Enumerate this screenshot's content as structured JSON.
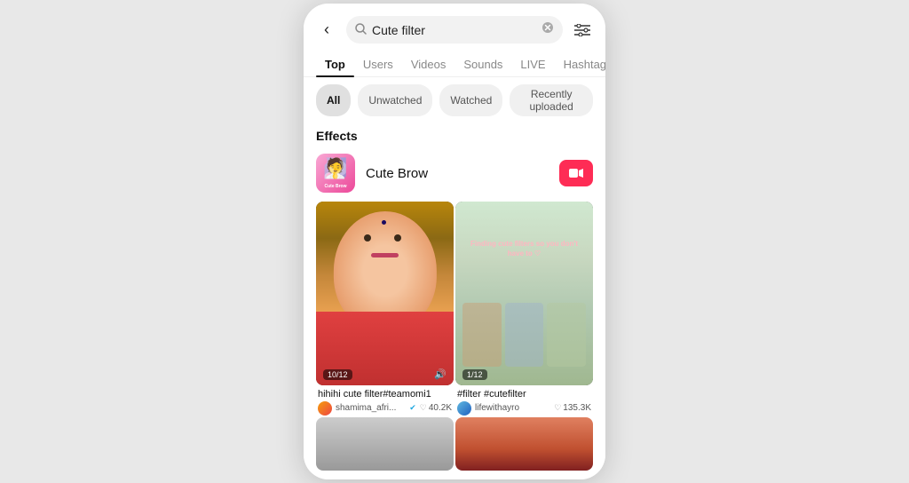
{
  "phone": {
    "header": {
      "back_label": "‹",
      "search_value": "Cute filter",
      "clear_icon": "✕",
      "filter_icon": "⊟"
    },
    "tabs": [
      {
        "label": "Top",
        "active": true
      },
      {
        "label": "Users",
        "active": false
      },
      {
        "label": "Videos",
        "active": false
      },
      {
        "label": "Sounds",
        "active": false
      },
      {
        "label": "LIVE",
        "active": false
      },
      {
        "label": "Hashtags",
        "active": false
      }
    ],
    "pills": [
      {
        "label": "All",
        "active": true
      },
      {
        "label": "Unwatched",
        "active": false
      },
      {
        "label": "Watched",
        "active": false
      },
      {
        "label": "Recently uploaded",
        "active": false
      }
    ],
    "effects_section": {
      "title": "Effects",
      "items": [
        {
          "name": "Cute Brow",
          "thumb_label": "Cute Brow",
          "record_icon": "▶"
        }
      ]
    },
    "videos": [
      {
        "badge": "10/12",
        "has_sound": true,
        "sound_icon": "🔊",
        "description": "hihihi cute filter#teamomi1",
        "username": "shamima_afri...",
        "verified": true,
        "likes": "40.2K"
      },
      {
        "badge": "1/12",
        "has_sound": false,
        "overlay_text": "Finding cute filters so you don't have to ♡",
        "description": "#filter #cutefilter",
        "username": "lifewithayro",
        "verified": false,
        "likes": "135.3K"
      }
    ]
  }
}
